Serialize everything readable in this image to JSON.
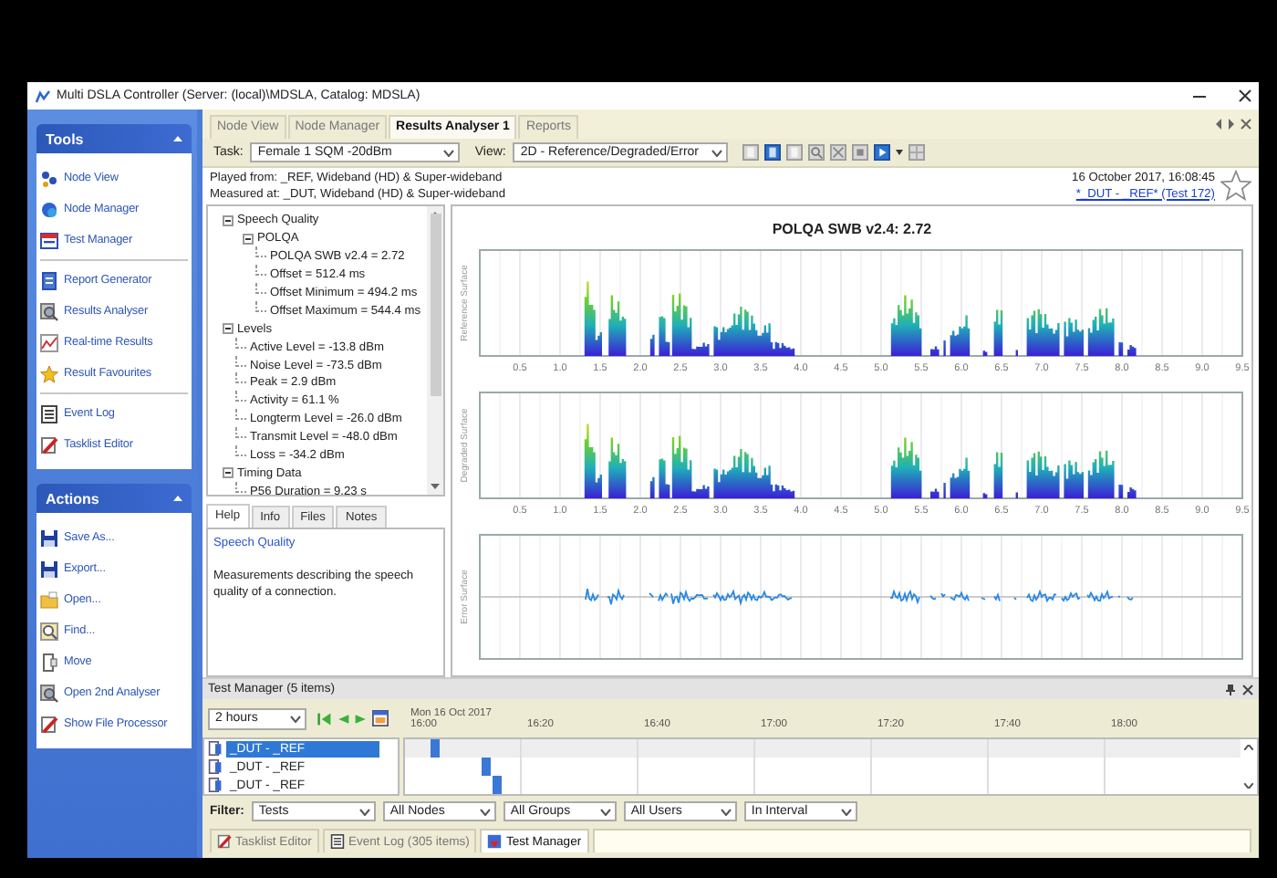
{
  "window": {
    "title": "Multi DSLA Controller (Server: (local)\\MDSLA, Catalog: MDSLA)"
  },
  "sidebar": {
    "panels": [
      {
        "title": "Tools",
        "groups": [
          {
            "items": [
              "Node View",
              "Node Manager",
              "Test Manager"
            ]
          },
          {
            "items": [
              "Report Generator",
              "Results Analyser",
              "Real-time Results",
              "Result Favourites"
            ]
          },
          {
            "items": [
              "Event Log",
              "Tasklist Editor"
            ]
          }
        ]
      },
      {
        "title": "Actions",
        "groups": [
          {
            "items": [
              "Save As...",
              "Export...",
              "Open...",
              "Find...",
              "Move",
              "Open 2nd Analyser",
              "Show File Processor"
            ]
          }
        ]
      }
    ]
  },
  "tabs": [
    {
      "label": "Node View",
      "selected": false
    },
    {
      "label": "Node Manager",
      "selected": false
    },
    {
      "label": "Results Analyser 1",
      "selected": true
    },
    {
      "label": "Reports",
      "selected": false
    }
  ],
  "toolbar": {
    "task": {
      "label": "Task:",
      "value": "Female 1 SQM -20dBm"
    },
    "view": {
      "label": "View:",
      "value": "2D - Reference/Degraded/Error"
    }
  },
  "info": {
    "played_from": "Played from: _REF, Wideband (HD) & Super-wideband",
    "measured_at": "Measured at: _DUT, Wideband (HD) & Super-wideband",
    "timestamp": "16 October 2017, 16:08:45",
    "test_link": "*_DUT - _REF* (Test 172)"
  },
  "tree": [
    {
      "label": "Speech Quality",
      "expanded": true,
      "children": [
        {
          "label": "POLQA",
          "expanded": true,
          "children": [
            {
              "label": "POLQA SWB v2.4 = 2.72"
            },
            {
              "label": "Offset = 512.4 ms"
            },
            {
              "label": "Offset Minimum = 494.2 ms"
            },
            {
              "label": "Offset Maximum = 544.4 ms"
            }
          ]
        }
      ]
    },
    {
      "label": "Levels",
      "expanded": true,
      "children": [
        {
          "label": "Active Level = -13.8 dBm"
        },
        {
          "label": "Noise Level = -73.5 dBm"
        },
        {
          "label": "Peak = 2.9 dBm"
        },
        {
          "label": "Activity = 61.1 %"
        },
        {
          "label": "Longterm Level = -26.0 dBm"
        },
        {
          "label": "Transmit Level = -48.0 dBm"
        },
        {
          "label": "Loss = -34.2 dBm"
        }
      ]
    },
    {
      "label": "Timing Data",
      "expanded": true,
      "children": [
        {
          "label": "P56 Duration = 9.23 s"
        }
      ]
    }
  ],
  "detail_tabs": [
    {
      "label": "Help",
      "selected": true
    },
    {
      "label": "Info",
      "selected": false
    },
    {
      "label": "Files",
      "selected": false
    },
    {
      "label": "Notes",
      "selected": false
    }
  ],
  "help": {
    "title": "Speech Quality",
    "text": "Measurements describing the speech quality of a connection."
  },
  "chart_panel": {
    "title": "POLQA SWB v2.4: 2.72",
    "plots": [
      {
        "kind": "spectrum",
        "axis_title": "Reference Surface",
        "tick_labels": [
          "0.5",
          "1.0",
          "1.5",
          "2.0",
          "2.5",
          "3.0",
          "3.5",
          "4.0",
          "4.5",
          "5.0",
          "5.5",
          "6.0",
          "6.5",
          "7.0",
          "7.5",
          "8.0",
          "8.5",
          "9.0",
          "9.5"
        ]
      },
      {
        "kind": "spectrum",
        "axis_title": "Degraded Surface",
        "tick_labels": [
          "0.5",
          "1.0",
          "1.5",
          "2.0",
          "2.5",
          "3.0",
          "3.5",
          "4.0",
          "4.5",
          "5.0",
          "5.5",
          "6.0",
          "6.5",
          "7.0",
          "7.5",
          "8.0",
          "8.5",
          "9.0",
          "9.5"
        ]
      },
      {
        "kind": "error",
        "axis_title": "Error Surface"
      }
    ]
  },
  "test_manager": {
    "title": "Test Manager (5 items)",
    "range": "2 hours",
    "date": "Mon 16 Oct 2017",
    "times": [
      "16:00",
      "16:20",
      "16:40",
      "17:00",
      "17:20",
      "17:40",
      "18:00"
    ],
    "rows": [
      {
        "label": "_DUT - _REF",
        "selected": true
      },
      {
        "label": "_DUT - _REF",
        "selected": false
      },
      {
        "label": "_DUT - _REF",
        "selected": false
      }
    ],
    "filter_label": "Filter:",
    "filters": [
      "Tests",
      "All Nodes",
      "All Groups",
      "All Users",
      "In Interval"
    ]
  },
  "bottom_tabs": [
    {
      "label": "Tasklist Editor",
      "selected": false
    },
    {
      "label": "Event Log (305 items)",
      "selected": false
    },
    {
      "label": "Test Manager",
      "selected": true
    }
  ]
}
